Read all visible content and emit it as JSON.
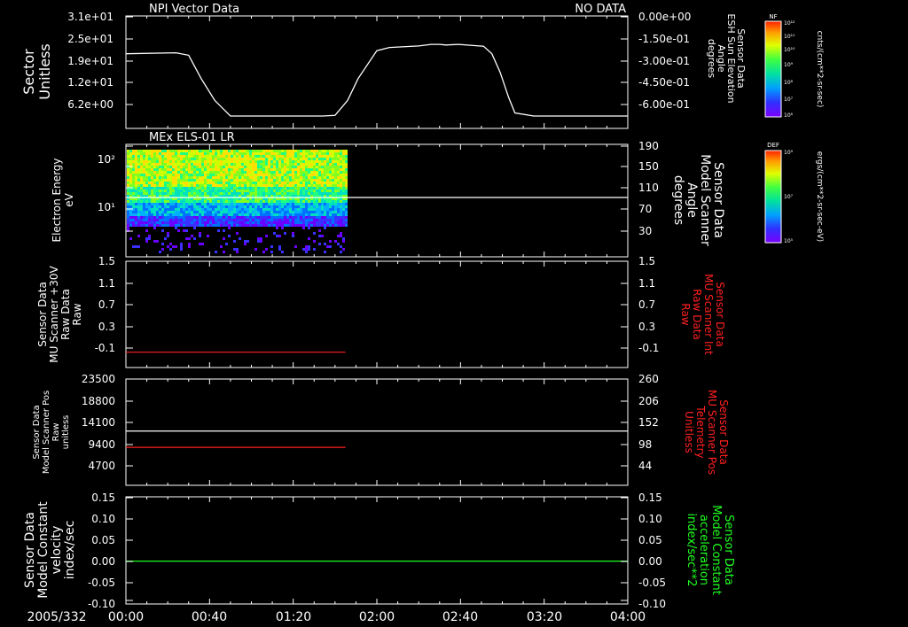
{
  "date_label": "2005/332",
  "x_ticks": [
    "00:00",
    "00:40",
    "01:20",
    "02:00",
    "02:40",
    "03:20",
    "04:00"
  ],
  "colors": {
    "white": "#ffffff",
    "red": "#ff2020",
    "green": "#20ff20",
    "background": "#000000"
  },
  "colorbars": [
    {
      "label": "NF",
      "top": "10¹²",
      "mid": [
        "10¹⁰",
        "10⁹",
        "10⁸",
        "10⁷"
      ],
      "extra": "10¹¹",
      "bottom": "10⁶",
      "units": "cnts/(cm**2-sr-sec)"
    },
    {
      "label": "DEF",
      "top": "10⁹",
      "mid": [
        "10⁷"
      ],
      "extra": "",
      "bottom": "10⁵",
      "units": "ergs/(cm**2-sr-sec-eV)"
    }
  ],
  "chart_data": [
    {
      "type": "line",
      "title": "NPI Vector Data",
      "status": "NO DATA",
      "ylabel": [
        "Sector",
        "Unitless"
      ],
      "yticks_left": [
        "3.1e+01",
        "2.5e+01",
        "1.9e+01",
        "1.2e+01",
        "6.2e+00"
      ],
      "ylabel_right": [
        "Sensor Data",
        "ESH Sun Elevation",
        "Angle",
        "degrees"
      ],
      "yticks_right": [
        "0.00e+00",
        "-1.50e-01",
        "-3.00e-01",
        "-4.50e-01",
        "-6.00e-01"
      ],
      "ylim": [
        0,
        31
      ],
      "xlim_min": [
        0,
        240
      ],
      "series": [
        {
          "color": "white",
          "x": [
            0,
            48,
            60,
            72,
            85,
            100,
            180,
            188,
            200,
            212,
            222,
            240,
            252,
            280,
            292,
            300,
            306,
            318,
            342,
            350,
            358,
            366,
            372,
            390,
            480
          ],
          "y": [
            20,
            20.3,
            19.5,
            12,
            5,
            0,
            0,
            0,
            0.2,
            5,
            12,
            21,
            22,
            22.5,
            23,
            23,
            22.8,
            23,
            22.4,
            20,
            14,
            6,
            1,
            0,
            0
          ]
        }
      ]
    },
    {
      "type": "heatmap",
      "title": "MEx ELS-01 LR",
      "ylabel": [
        "Electron Energy",
        "eV"
      ],
      "yticks_left": [
        "10²",
        "10¹"
      ],
      "ylabel_right": [
        "Sensor Data",
        "Model Scanner",
        "Angle",
        "degrees"
      ],
      "yticks_right": [
        "190",
        "150",
        "110",
        "70",
        "30"
      ],
      "data_end_min": 105,
      "series": [
        {
          "color": "white",
          "name": "",
          "y_right": 105
        }
      ]
    },
    {
      "type": "line",
      "ylabel": [
        "Sensor Data",
        "MU Scanner +30V",
        "Raw Data",
        "Raw"
      ],
      "yticks_left": [
        "1.5",
        "1.1",
        "0.7",
        "0.3",
        "-0.1"
      ],
      "ylabel_right": [
        "Sensor Data",
        "MU Scanner Int",
        "Raw Data",
        "Raw"
      ],
      "yticks_right": [
        "1.5",
        "1.1",
        "0.7",
        "0.3",
        "-0.1"
      ],
      "ylim": [
        -0.3,
        1.5
      ],
      "series": [
        {
          "color": "red",
          "x": [
            0,
            105
          ],
          "y": [
            -0.04,
            -0.04
          ]
        }
      ]
    },
    {
      "type": "line",
      "ylabel": [
        "Sensor Data",
        "Model Scanner Pos",
        "Raw",
        "unitless"
      ],
      "yticks_left": [
        "23500",
        "18800",
        "14100",
        "9400",
        "4700"
      ],
      "ylabel_right": [
        "Sensor Data",
        "MU Scanner Pos",
        "Telemetry",
        "Unitless"
      ],
      "yticks_right": [
        "260",
        "206",
        "152",
        "98",
        "44"
      ],
      "ylim": [
        0,
        23500
      ],
      "series": [
        {
          "color": "white",
          "x": [
            0,
            240
          ],
          "y": [
            12000,
            12000
          ]
        },
        {
          "color": "red",
          "x": [
            0,
            105
          ],
          "y": [
            8400,
            8400
          ]
        }
      ]
    },
    {
      "type": "line",
      "ylabel": [
        "Sensor Data",
        "Model Constant",
        "velocity",
        "index/sec"
      ],
      "yticks_left": [
        "0.15",
        "0.10",
        "0.05",
        "0.00",
        "-0.05",
        "-0.10"
      ],
      "ylabel_right": [
        "Sensor Data",
        "Model Constant",
        "acceleration",
        "index/sec**2"
      ],
      "yticks_right": [
        "0.15",
        "0.10",
        "0.05",
        "0.00",
        "-0.05",
        "-0.10"
      ],
      "ylim": [
        -0.1,
        0.15
      ],
      "series": [
        {
          "color": "green",
          "x": [
            0,
            240
          ],
          "y": [
            0,
            0
          ]
        }
      ]
    }
  ]
}
